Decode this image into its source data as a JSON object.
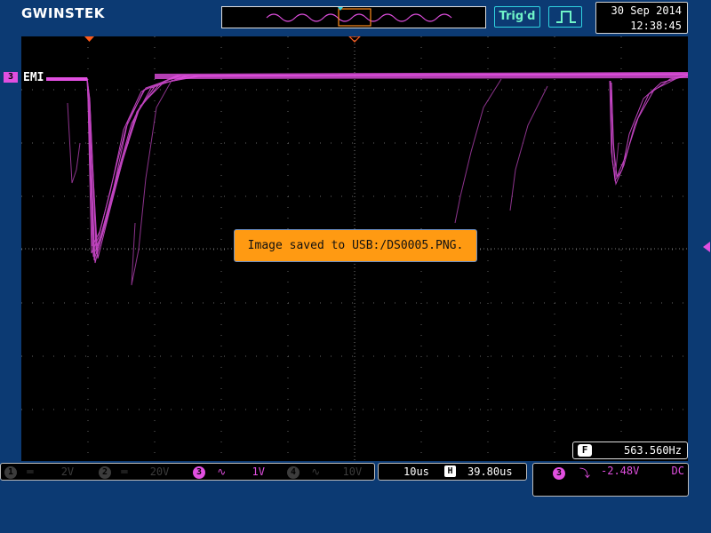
{
  "brand": {
    "logo": "GWINSTEK"
  },
  "status": {
    "trigger_state": "Trig'd",
    "date": "30 Sep 2014",
    "time": "12:38:45"
  },
  "waveform": {
    "channel_number": "3",
    "channel_label": "EMI",
    "channel_color": "#e14fe0"
  },
  "message": {
    "text": "Image saved to USB:/DS0005.PNG."
  },
  "frequency": {
    "icon": "F",
    "value": "563.560Hz"
  },
  "channels": [
    {
      "number": "1",
      "coupling": "DC",
      "scale": "2V",
      "active": false
    },
    {
      "number": "2",
      "coupling": "DC",
      "scale": "20V",
      "active": false
    },
    {
      "number": "3",
      "coupling": "AC",
      "scale": "1V",
      "active": true
    },
    {
      "number": "4",
      "coupling": "AC",
      "scale": "10V",
      "active": false
    }
  ],
  "timebase": {
    "scale": "10us",
    "h_icon": "H",
    "position": "39.80us"
  },
  "trigger": {
    "source": "3",
    "slope": "falling",
    "level": "-2.48V",
    "coupling": "DC"
  },
  "colors": {
    "background": "#0c3a73",
    "accent": "#ff9a12",
    "trace": "#e14fe0",
    "status": "#6ff4c8"
  }
}
